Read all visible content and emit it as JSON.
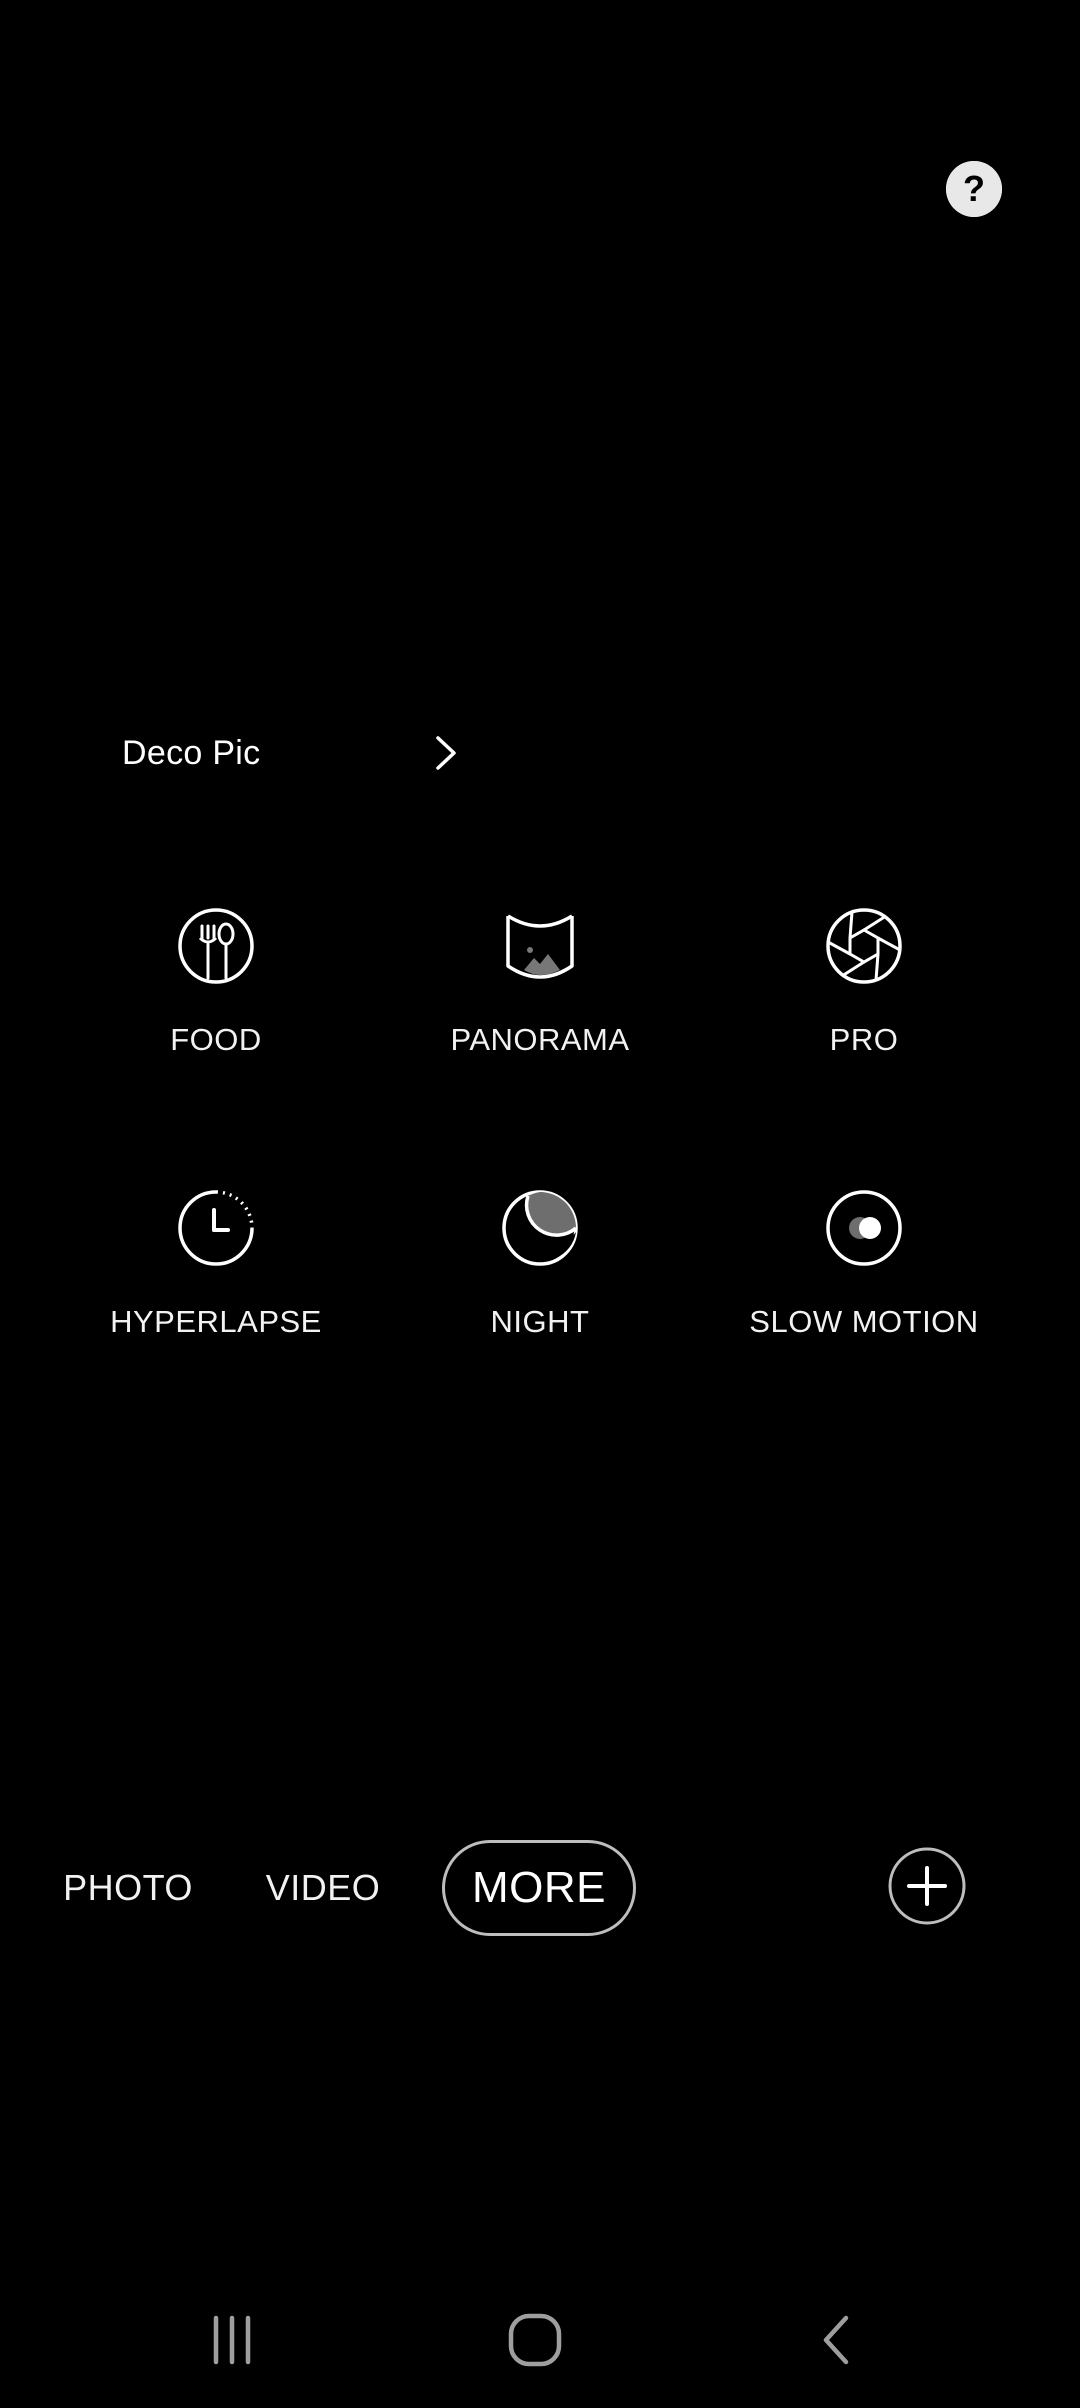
{
  "colors": {
    "background": "#000000",
    "text": "#ffffff",
    "icon_stroke": "#ffffff",
    "help_fill": "#e8e8e8",
    "pill_border": "#bdbdbd",
    "nav_icon": "#9e9e9e"
  },
  "help": {
    "glyph": "?",
    "icon": "help-circle-icon"
  },
  "deco_pic": {
    "label": "Deco Pic",
    "icon": "chevron-right-icon"
  },
  "modes": [
    {
      "label": "FOOD",
      "icon": "food-fork-spoon-icon"
    },
    {
      "label": "PANORAMA",
      "icon": "panorama-icon"
    },
    {
      "label": "PRO",
      "icon": "aperture-icon"
    },
    {
      "label": "HYPERLAPSE",
      "icon": "hyperlapse-clock-icon"
    },
    {
      "label": "NIGHT",
      "icon": "moon-icon"
    },
    {
      "label": "SLOW MOTION",
      "icon": "slow-motion-icon"
    }
  ],
  "mode_bar": {
    "tabs": [
      {
        "label": "PHOTO",
        "selected": false
      },
      {
        "label": "VIDEO",
        "selected": false
      },
      {
        "label": "MORE",
        "selected": true
      }
    ],
    "add_icon": "plus-circle-icon"
  },
  "nav_bar": {
    "recents_icon": "recents-icon",
    "home_icon": "home-icon",
    "back_icon": "back-icon"
  }
}
